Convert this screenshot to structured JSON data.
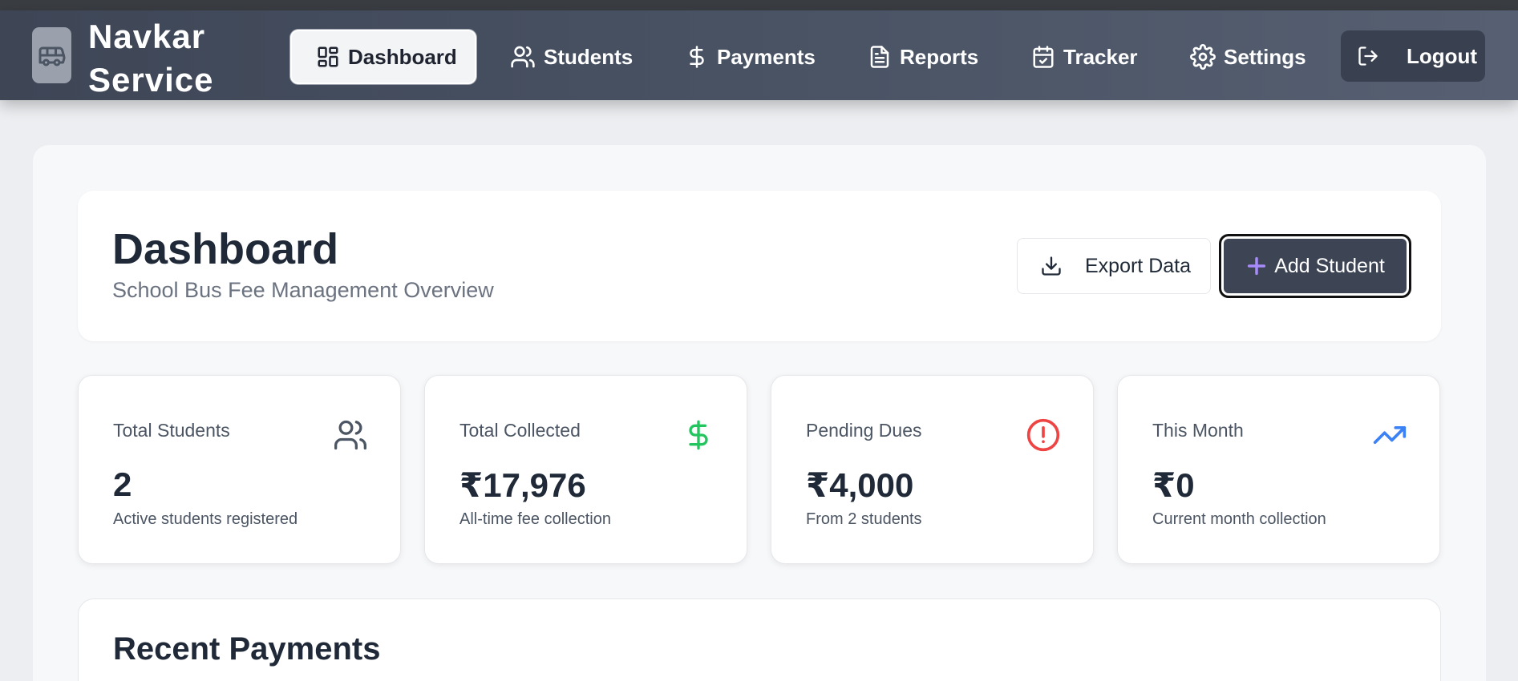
{
  "app": {
    "brand_line1": "Navkar",
    "brand_line2": "Service",
    "logo_icon": "bus-icon"
  },
  "nav": {
    "items": [
      {
        "label": "Dashboard",
        "icon": "layout-dashboard-icon",
        "active": true
      },
      {
        "label": "Students",
        "icon": "users-icon"
      },
      {
        "label": "Payments",
        "icon": "dollar-sign-icon"
      },
      {
        "label": "Reports",
        "icon": "file-text-icon"
      },
      {
        "label": "Tracker",
        "icon": "calendar-check-icon"
      },
      {
        "label": "Settings",
        "icon": "gear-icon"
      }
    ],
    "logout_label": "Logout"
  },
  "header": {
    "title": "Dashboard",
    "subtitle": "School Bus Fee Management Overview",
    "export_label": "Export Data",
    "add_label": "Add Student"
  },
  "stats": [
    {
      "label": "Total Students",
      "value": "2",
      "note": "Active students registered",
      "icon": "users-icon",
      "icon_color": "#4b5563"
    },
    {
      "label": "Total Collected",
      "value": "₹17,976",
      "note": "All-time fee collection",
      "icon": "dollar-sign-icon",
      "icon_color": "#22c55e"
    },
    {
      "label": "Pending Dues",
      "value": "₹4,000",
      "note": "From 2 students",
      "icon": "alert-circle-icon",
      "icon_color": "#ef4444"
    },
    {
      "label": "This Month",
      "value": "₹0",
      "note": "Current month collection",
      "icon": "trending-up-icon",
      "icon_color": "#3b82f6"
    }
  ],
  "recent": {
    "title": "Recent Payments"
  },
  "colors": {
    "navbar": "#4b5566",
    "accent_plus": "#a78bfa",
    "primary_button": "#3d4454"
  }
}
